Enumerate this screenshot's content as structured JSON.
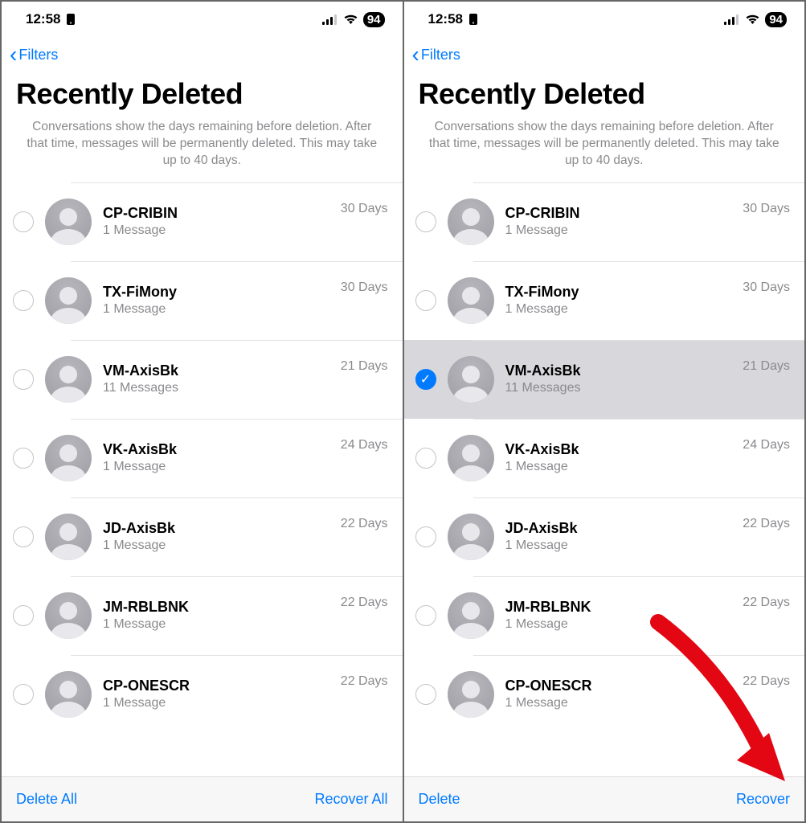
{
  "status": {
    "time": "12:58",
    "battery": "94"
  },
  "nav": {
    "back_label": "Filters"
  },
  "header": {
    "title": "Recently Deleted",
    "description": "Conversations show the days remaining before deletion. After that time, messages will be permanently deleted. This may take up to 40 days."
  },
  "screens": [
    {
      "toolbar": {
        "left": "Delete All",
        "right": "Recover All"
      },
      "rows": [
        {
          "name": "CP-CRIBIN",
          "sub": "1 Message",
          "days": "30 Days",
          "selected": false
        },
        {
          "name": "TX-FiMony",
          "sub": "1 Message",
          "days": "30 Days",
          "selected": false
        },
        {
          "name": "VM-AxisBk",
          "sub": "11 Messages",
          "days": "21 Days",
          "selected": false
        },
        {
          "name": "VK-AxisBk",
          "sub": "1 Message",
          "days": "24 Days",
          "selected": false
        },
        {
          "name": "JD-AxisBk",
          "sub": "1 Message",
          "days": "22 Days",
          "selected": false
        },
        {
          "name": "JM-RBLBNK",
          "sub": "1 Message",
          "days": "22 Days",
          "selected": false
        },
        {
          "name": "CP-ONESCR",
          "sub": "1 Message",
          "days": "22 Days",
          "selected": false
        }
      ],
      "annotated": false
    },
    {
      "toolbar": {
        "left": "Delete",
        "right": "Recover"
      },
      "rows": [
        {
          "name": "CP-CRIBIN",
          "sub": "1 Message",
          "days": "30 Days",
          "selected": false
        },
        {
          "name": "TX-FiMony",
          "sub": "1 Message",
          "days": "30 Days",
          "selected": false
        },
        {
          "name": "VM-AxisBk",
          "sub": "11 Messages",
          "days": "21 Days",
          "selected": true
        },
        {
          "name": "VK-AxisBk",
          "sub": "1 Message",
          "days": "24 Days",
          "selected": false
        },
        {
          "name": "JD-AxisBk",
          "sub": "1 Message",
          "days": "22 Days",
          "selected": false
        },
        {
          "name": "JM-RBLBNK",
          "sub": "1 Message",
          "days": "22 Days",
          "selected": false
        },
        {
          "name": "CP-ONESCR",
          "sub": "1 Message",
          "days": "22 Days",
          "selected": false
        }
      ],
      "annotated": true
    }
  ]
}
